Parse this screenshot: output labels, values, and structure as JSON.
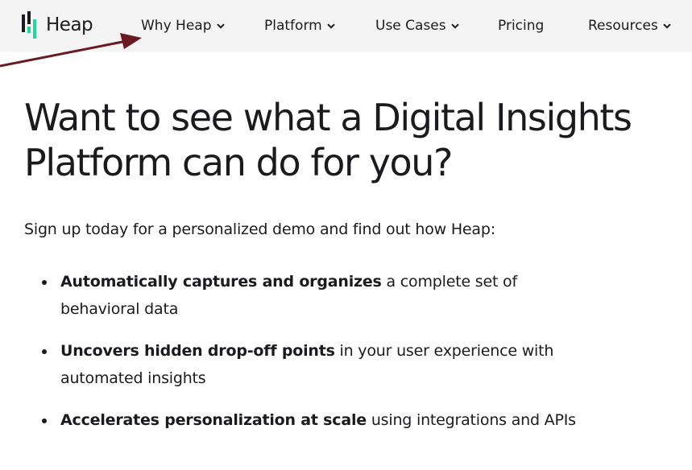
{
  "brand": {
    "name": "Heap",
    "logo_colors": {
      "dark": "#1b1b1f",
      "green": "#1fd99a"
    }
  },
  "nav": {
    "items": [
      {
        "label": "Why Heap",
        "has_dropdown": true
      },
      {
        "label": "Platform",
        "has_dropdown": true
      },
      {
        "label": "Use Cases",
        "has_dropdown": true
      },
      {
        "label": "Pricing",
        "has_dropdown": false
      },
      {
        "label": "Resources",
        "has_dropdown": true
      }
    ]
  },
  "hero": {
    "title": "Want to see what a Digital Insights Platform can do for you?",
    "intro": "Sign up today for a personalized demo and find out how Heap:"
  },
  "bullets": [
    {
      "bold": "Automatically captures and organizes",
      "rest": " a complete set of behavioral data"
    },
    {
      "bold": "Uncovers hidden drop-off points",
      "rest": " in your user experience with automated insights"
    },
    {
      "bold": "Accelerates personalization at scale",
      "rest": " using integrations and APIs"
    }
  ],
  "annotation": {
    "type": "arrow",
    "color": "#6b1a22",
    "points_to": "Why Heap"
  },
  "colors": {
    "nav_bg": "#f4f4f4",
    "text": "#1b1b1f",
    "page_bg": "#ffffff"
  }
}
